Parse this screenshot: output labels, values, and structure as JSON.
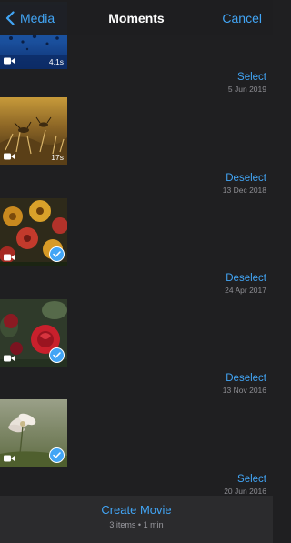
{
  "theme": {
    "accent": "#42a5f5",
    "background": "#1f1f21",
    "secondary_text": "#8e8e93",
    "toolbar": "#2b2b2d"
  },
  "navbar": {
    "back_icon": "chevron-left-icon",
    "back_label": "Media",
    "title": "Moments",
    "cancel_label": "Cancel"
  },
  "moments": [
    {
      "action": "",
      "date": "",
      "duration": "4,1s",
      "selected": false,
      "is_video": true
    },
    {
      "action": "Select",
      "date": "5 Jun 2019",
      "duration": "17s",
      "selected": false,
      "is_video": true
    },
    {
      "action": "Deselect",
      "date": "13 Dec 2018",
      "duration": "",
      "selected": true,
      "is_video": true
    },
    {
      "action": "Deselect",
      "date": "24 Apr 2017",
      "duration": "",
      "selected": true,
      "is_video": true
    },
    {
      "action": "Deselect",
      "date": "13 Nov 2016",
      "duration": "",
      "selected": true,
      "is_video": true
    },
    {
      "action": "Select",
      "date": "20 Jun 2016",
      "duration": "",
      "selected": false,
      "is_video": false
    }
  ],
  "bottom_bar": {
    "create_label": "Create Movie",
    "summary": "3 items • 1 min"
  }
}
